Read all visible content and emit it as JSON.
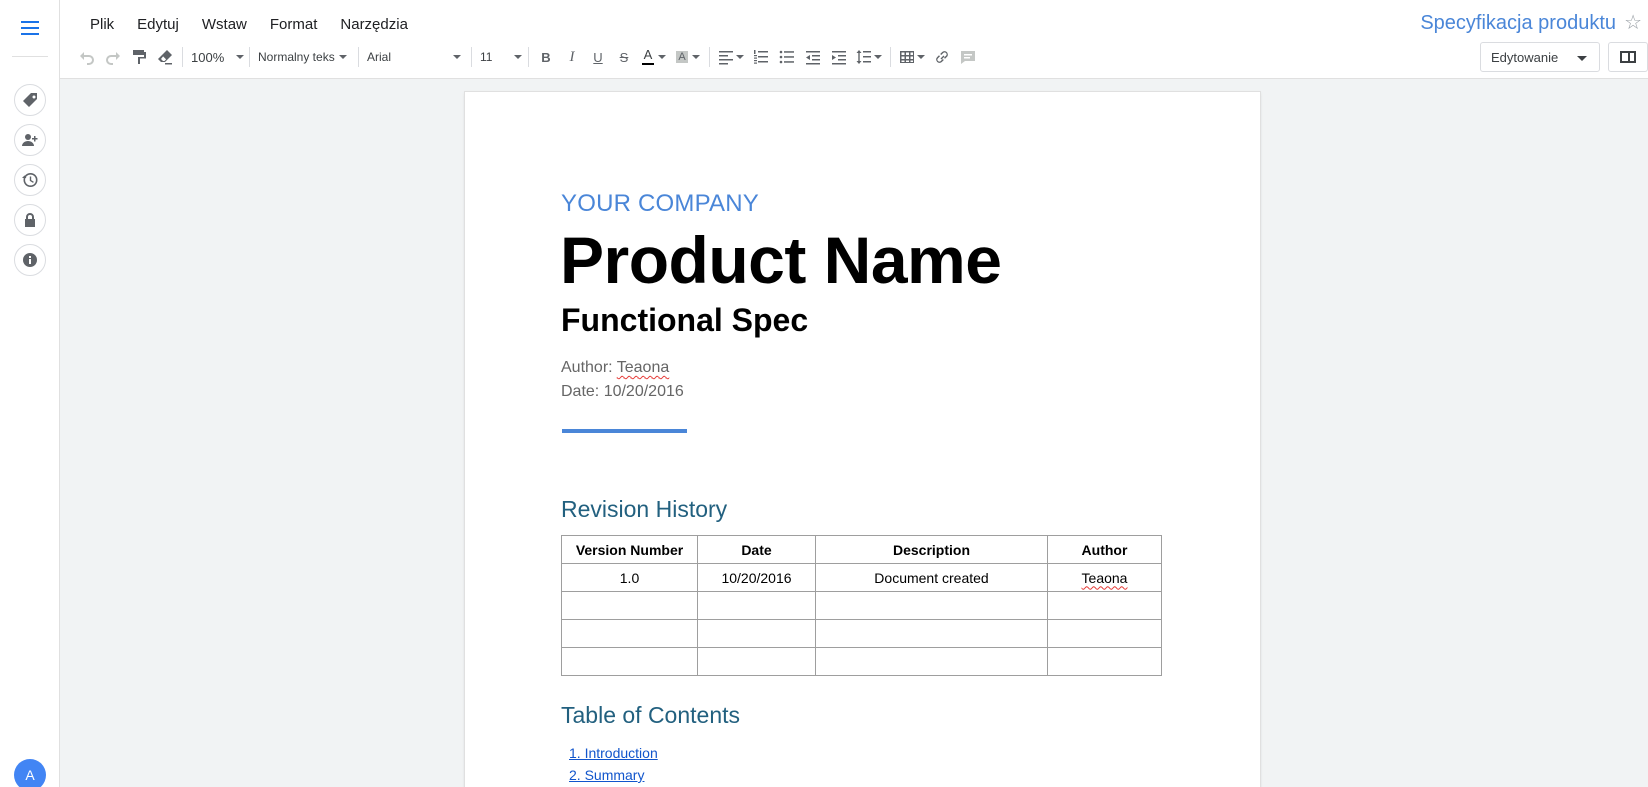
{
  "app": {
    "menu": [
      "Plik",
      "Edytuj",
      "Wstaw",
      "Format",
      "Narzędzia"
    ],
    "doc_title": "Specyfikacja produktu",
    "mode": "Edytowanie",
    "avatar_letter": "A"
  },
  "toolbar": {
    "zoom": "100%",
    "style": "Normalny teks",
    "font": "Arial",
    "size": "11"
  },
  "rail": {
    "icons": [
      "tag-icon",
      "add-person-icon",
      "history-icon",
      "lock-icon",
      "info-icon"
    ]
  },
  "document": {
    "company": "YOUR COMPANY",
    "product": "Product Name",
    "subtitle": "Functional Spec",
    "author_label": "Author: ",
    "author": "Teaona",
    "date_line": "Date: 10/20/2016",
    "revision_heading": "Revision History",
    "revision_table": {
      "headers": [
        "Version Number",
        "Date",
        "Description",
        "Author"
      ],
      "rows": [
        [
          "1.0",
          "10/20/2016",
          "Document created",
          "Teaona"
        ],
        [
          "",
          "",
          "",
          ""
        ],
        [
          "",
          "",
          "",
          ""
        ],
        [
          "",
          "",
          "",
          ""
        ]
      ]
    },
    "toc_heading": "Table of Contents",
    "toc": [
      "1. Introduction",
      "2. Summary"
    ]
  },
  "colors": {
    "accent": "#4a86d8",
    "heading": "#22607f",
    "link": "#1155cc"
  }
}
